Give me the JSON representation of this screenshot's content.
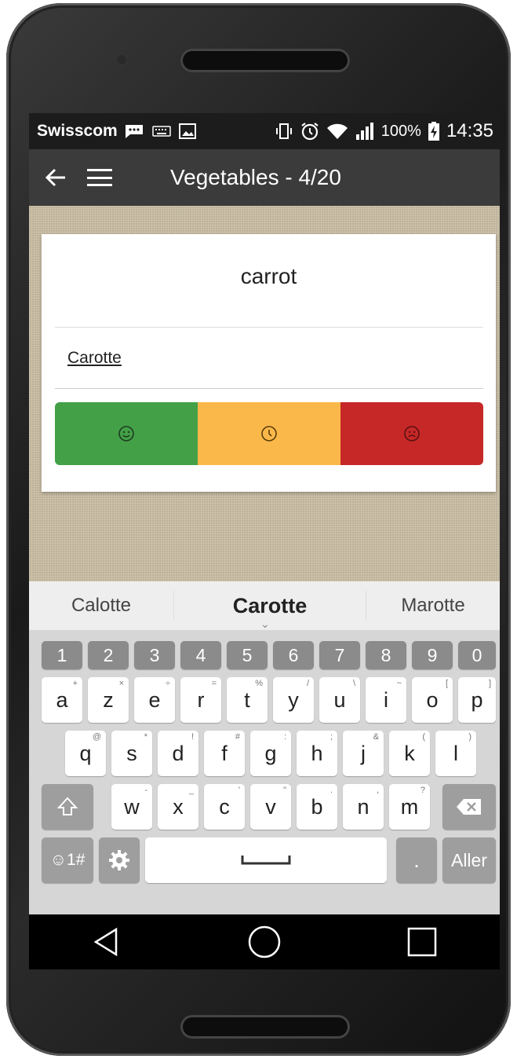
{
  "status_bar": {
    "carrier": "Swisscom",
    "battery": "100%",
    "time": "14:35",
    "icons": [
      "message-icon",
      "keyboard-icon",
      "image-icon",
      "vibrate-icon",
      "alarm-icon",
      "wifi-icon",
      "signal-icon",
      "battery-charging-icon"
    ]
  },
  "app_bar": {
    "title": "Vegetables - 4/20",
    "icons": [
      "back-arrow-icon",
      "hamburger-menu-icon"
    ]
  },
  "card": {
    "word": "carrot",
    "answer": "Carotte",
    "buttons": [
      {
        "name": "known",
        "icon": "smile-icon",
        "color": "#43a047"
      },
      {
        "name": "later",
        "icon": "clock-icon",
        "color": "#fbb84a"
      },
      {
        "name": "unknown",
        "icon": "sad-icon",
        "color": "#c62828"
      }
    ]
  },
  "suggestions": [
    "Calotte",
    "Carotte",
    "Marotte"
  ],
  "keyboard": {
    "numbers": [
      "1",
      "2",
      "3",
      "4",
      "5",
      "6",
      "7",
      "8",
      "9",
      "0"
    ],
    "row1": [
      "a",
      "z",
      "e",
      "r",
      "t",
      "y",
      "u",
      "i",
      "o",
      "p"
    ],
    "row1_sup": [
      "+",
      "×",
      "÷",
      "=",
      "%",
      "/",
      "\\",
      "~",
      "[",
      "]"
    ],
    "row2": [
      "q",
      "s",
      "d",
      "f",
      "g",
      "h",
      "j",
      "k",
      "l"
    ],
    "row2_sup": [
      "@",
      "*",
      "!",
      "#",
      ":",
      ";",
      "&",
      "(",
      ")"
    ],
    "row3": [
      "w",
      "x",
      "c",
      "v",
      "b",
      "n",
      "m"
    ],
    "row3_sup": [
      "-",
      "_",
      "'",
      "\"",
      ".",
      ",",
      "?"
    ],
    "symbols_label": "☺1#",
    "enter_label": "Aller",
    "period_label": "."
  },
  "nav_bar": {
    "icons": [
      "back-triangle-icon",
      "home-circle-icon",
      "recents-square-icon"
    ]
  }
}
